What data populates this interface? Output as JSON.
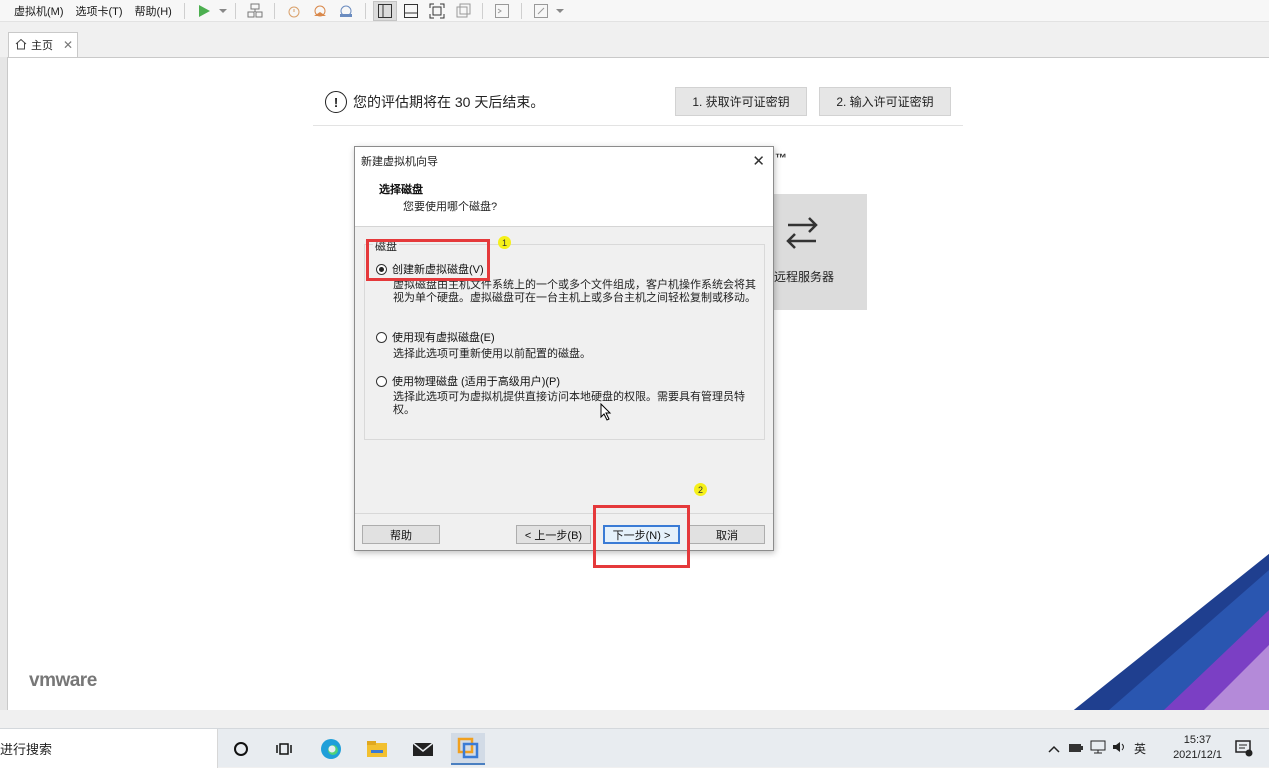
{
  "menubar": {
    "menus": [
      "虚拟机(M)",
      "选项卡(T)",
      "帮助(H)"
    ],
    "toolbar_icons": [
      "play-icon",
      "dropdown-arrow-icon",
      "network-icon",
      "snapshot-icon",
      "snapshot-restore-icon",
      "snapshot-manager-icon",
      "normal-view-icon",
      "console-view-icon",
      "fullscreen-icon",
      "unity-icon",
      "terminal-icon",
      "stretch-icon"
    ]
  },
  "tabs": [
    {
      "label": "主页",
      "icon": "home-icon"
    }
  ],
  "home": {
    "eval_text": "您的评估期将在 30 天后结束。",
    "get_license_label": "1. 获取许可证密钥",
    "enter_license_label": "2. 输入许可证密钥",
    "trademark": "™",
    "remote_server_label": "远程服务器",
    "logo": "vmware"
  },
  "dialog": {
    "title": "新建虚拟机向导",
    "heading": "选择磁盘",
    "subheading": "您要使用哪个磁盘?",
    "group_label": "磁盘",
    "options": [
      {
        "label": "创建新虚拟磁盘(V)",
        "selected": true,
        "desc": "虚拟磁盘由主机文件系统上的一个或多个文件组成，客户机操作系统会将其视为单个硬盘。虚拟磁盘可在一台主机上或多台主机之间轻松复制或移动。"
      },
      {
        "label": "使用现有虚拟磁盘(E)",
        "selected": false,
        "desc": "选择此选项可重新使用以前配置的磁盘。"
      },
      {
        "label": "使用物理磁盘 (适用于高级用户)(P)",
        "selected": false,
        "desc": "选择此选项可为虚拟机提供直接访问本地硬盘的权限。需要具有管理员特权。"
      }
    ],
    "buttons": {
      "help": "帮助",
      "back": "< 上一步(B)",
      "next": "下一步(N) >",
      "cancel": "取消"
    }
  },
  "annotations": {
    "badge1": "1",
    "badge2": "2",
    "color": "#e5393b"
  },
  "taskbar": {
    "search_text": "进行搜索",
    "apps": [
      "cortana-icon",
      "task-view-icon",
      "edge-icon",
      "file-explorer-icon",
      "mail-icon",
      "vmware-icon"
    ],
    "tray_ime": "英",
    "time": "15:37",
    "date": "2021/12/1"
  }
}
